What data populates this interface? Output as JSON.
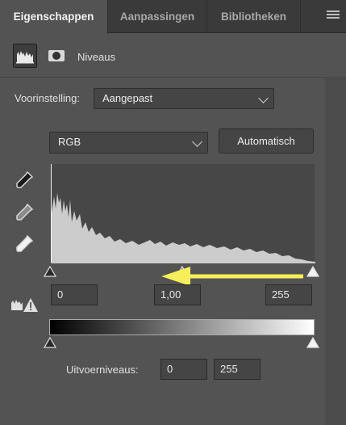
{
  "tabs": [
    {
      "label": "Eigenschappen",
      "active": true
    },
    {
      "label": "Aanpassingen",
      "active": false
    },
    {
      "label": "Bibliotheken",
      "active": false
    }
  ],
  "header": {
    "title": "Niveaus",
    "icons": [
      "levels-histogram-icon",
      "layer-mask-icon"
    ]
  },
  "preset": {
    "label": "Voorinstelling:",
    "value": "Aangepast"
  },
  "channel": {
    "value": "RGB"
  },
  "auto_button": "Automatisch",
  "input_levels": {
    "black": "0",
    "gamma": "1,00",
    "white": "255"
  },
  "output_levels": {
    "label": "Uitvoerniveaus:",
    "black": "0",
    "white": "255"
  },
  "eyedroppers": [
    "black-point-eyedropper-icon",
    "gray-point-eyedropper-icon",
    "white-point-eyedropper-icon"
  ],
  "annotation": {
    "arrow_color": "#f6ef5a"
  },
  "colors": {
    "panel": "#535353",
    "tabbar": "#3a3a3a",
    "field": "#454545",
    "histogram_fill": "#cccccc"
  }
}
